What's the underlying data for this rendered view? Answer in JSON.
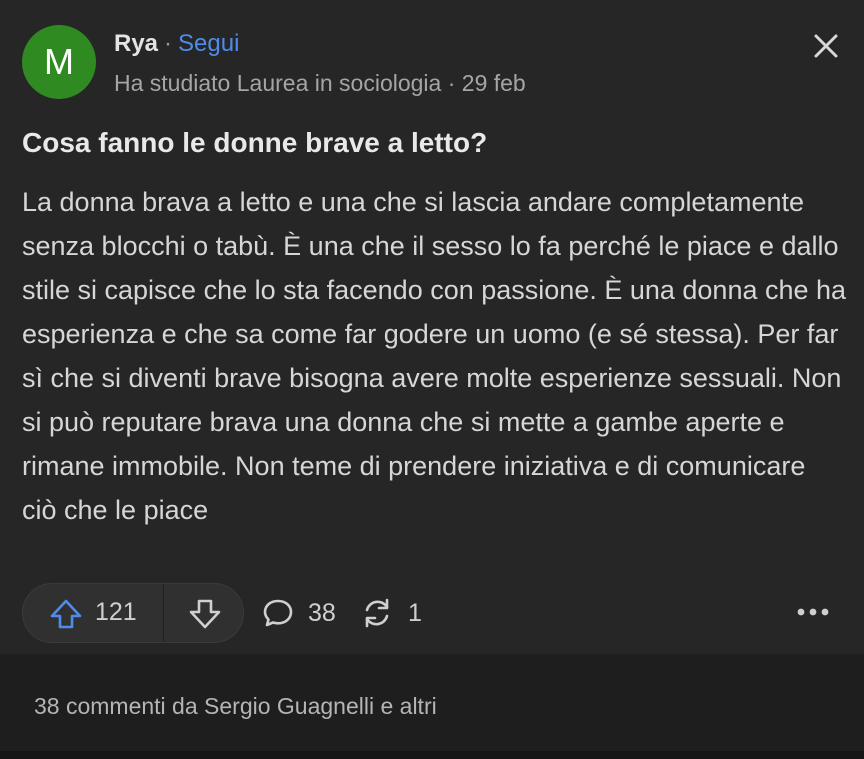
{
  "post": {
    "author": {
      "avatar_letter": "M",
      "name": "Rya",
      "separator": "·",
      "follow_label": "Segui",
      "credential": "Ha studiato Laurea in sociologia",
      "date_separator": "·",
      "date": "29 feb"
    },
    "title": "Cosa fanno le donne brave a letto?",
    "body": "La donna brava a letto e una che si lascia andare completamente senza blocchi o tabù. È una che il sesso lo fa perché le piace e dallo stile si capisce che lo sta facendo con passione. È una donna che ha esperienza e che sa come far godere un uomo (e sé stessa). Per far sì che si diventi brave bisogna avere molte esperienze sessuali. Non si può reputare brava una donna che si mette a gambe aperte e rimane immobile. Non teme di prendere iniziativa e di comunicare ciò che le piace",
    "actions": {
      "upvotes": "121",
      "comments": "38",
      "shares": "1"
    },
    "comments_summary": "38 commenti da Sergio Guagnelli e altri"
  },
  "colors": {
    "avatar_bg": "#2f8a22",
    "follow_link": "#4f8bea",
    "upvote_icon": "#4f8bea",
    "card_bg": "#262626"
  },
  "icons": [
    "close-icon",
    "upvote-arrow-icon",
    "downvote-arrow-icon",
    "comment-bubble-icon",
    "share-refresh-icon",
    "more-dots-icon"
  ]
}
